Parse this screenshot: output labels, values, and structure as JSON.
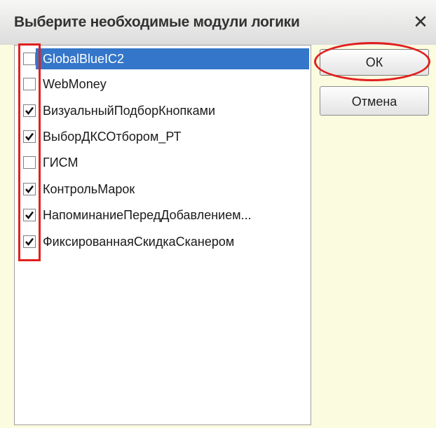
{
  "dialog": {
    "title": "Выберите необходимые модули логики",
    "close_glyph": "✕"
  },
  "modules": [
    {
      "label": "GlobalBlueIC2",
      "checked": false,
      "selected": true
    },
    {
      "label": "WebMoney",
      "checked": false,
      "selected": false
    },
    {
      "label": "ВизуальныйПодборКнопками",
      "checked": true,
      "selected": false
    },
    {
      "label": "ВыборДКСОтбором_РТ",
      "checked": true,
      "selected": false
    },
    {
      "label": "ГИСМ",
      "checked": false,
      "selected": false
    },
    {
      "label": "КонтрольМарок",
      "checked": true,
      "selected": false
    },
    {
      "label": "НапоминаниеПередДобавлением...",
      "checked": true,
      "selected": false
    },
    {
      "label": "ФиксированнаяСкидкаСканером",
      "checked": true,
      "selected": false
    }
  ],
  "buttons": {
    "ok_label": "ОК",
    "cancel_label": "Отмена"
  },
  "colors": {
    "selection": "#3476c9",
    "annotation": "#e0201e"
  }
}
